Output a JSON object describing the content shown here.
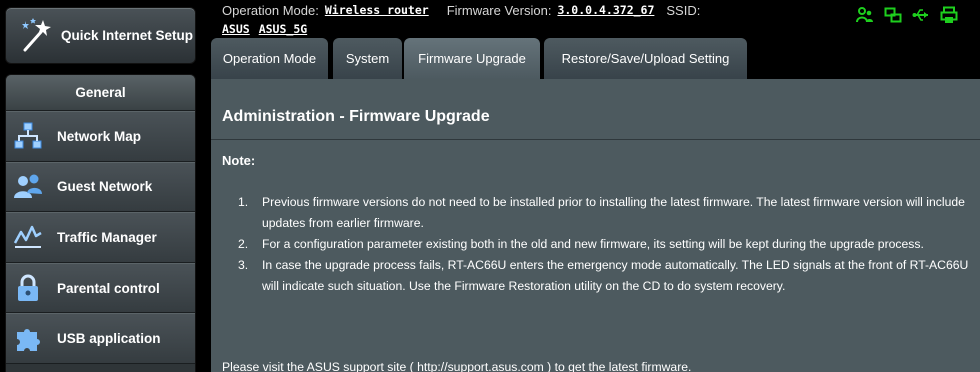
{
  "sidebar": {
    "quick_setup": {
      "label": "Quick Internet Setup",
      "icon": "magic-wand-icon"
    },
    "section_title": "General",
    "items": [
      {
        "label": "Network Map",
        "icon": "network-map-icon"
      },
      {
        "label": "Guest Network",
        "icon": "guest-network-icon"
      },
      {
        "label": "Traffic Manager",
        "icon": "traffic-manager-icon"
      },
      {
        "label": "Parental control",
        "icon": "lock-icon"
      },
      {
        "label": "USB application",
        "icon": "puzzle-icon"
      }
    ]
  },
  "status": {
    "op_mode_label": "Operation Mode:",
    "op_mode_value": "Wireless router",
    "fw_label": "Firmware Version:",
    "fw_value": "3.0.0.4.372_67",
    "ssid_label": "SSID:",
    "ssids": [
      "ASUS",
      "ASUS_5G"
    ],
    "icon_color": "#1ecf1e",
    "icons": [
      "clients-icon",
      "network-icon",
      "usb-icon",
      "printer-icon"
    ]
  },
  "tabs": [
    {
      "label": "Operation Mode",
      "active": false
    },
    {
      "label": "System",
      "active": false
    },
    {
      "label": "Firmware Upgrade",
      "active": true
    },
    {
      "label": "Restore/Save/Upload Setting",
      "active": false
    }
  ],
  "content": {
    "title": "Administration - Firmware Upgrade",
    "note_label": "Note:",
    "notes": [
      {
        "num": "1.",
        "text": "Previous firmware versions do not need to be installed prior to installing the latest firmware. The latest firmware version will include updates from earlier firmware."
      },
      {
        "num": "2.",
        "text": "For a configuration parameter existing both in the old and new firmware, its setting will be kept during the upgrade process."
      },
      {
        "num": "3.",
        "text": "In case the upgrade process fails, RT-AC66U enters the emergency mode automatically. The LED signals at the front of RT-AC66U will indicate such situation. Use the Firmware Restoration utility on the CD to do system recovery."
      }
    ],
    "footer": "Please visit the ASUS support site ( http://support.asus.com ) to get the latest firmware."
  }
}
